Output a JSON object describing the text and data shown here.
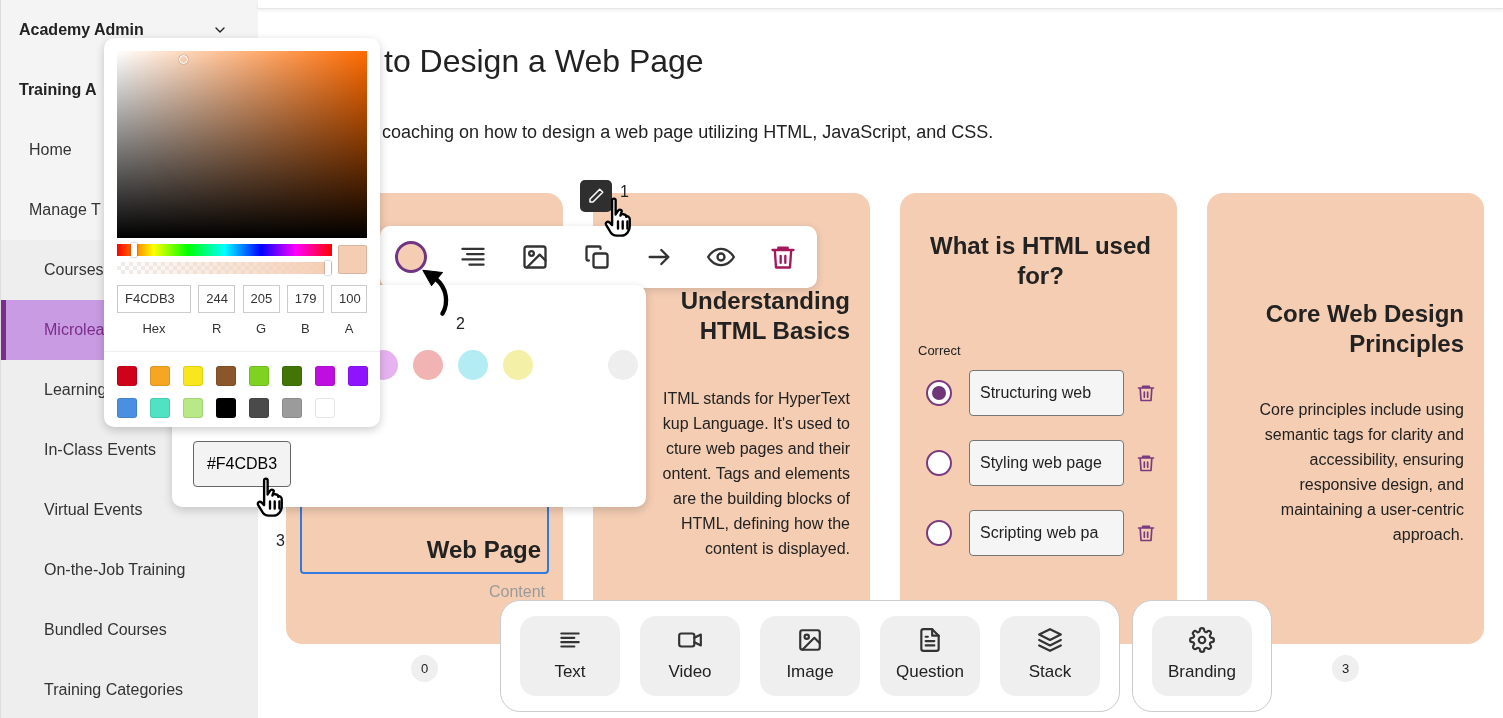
{
  "sidebar": {
    "items": [
      {
        "kind": "section",
        "label": "Academy Admin",
        "expanded": false
      },
      {
        "kind": "section",
        "label": "Training A"
      },
      {
        "kind": "item",
        "label": "Home",
        "selected": false
      },
      {
        "kind": "item",
        "label": "Manage T",
        "selected": false
      },
      {
        "kind": "subitem",
        "label": "Courses",
        "selected": false
      },
      {
        "kind": "subitem",
        "label": "Microlea",
        "selected": true
      },
      {
        "kind": "subitem",
        "label": "Learning",
        "selected": false
      },
      {
        "kind": "subitem",
        "label": "In-Class Events",
        "selected": false
      },
      {
        "kind": "subitem",
        "label": "Virtual Events",
        "selected": false
      },
      {
        "kind": "subitem",
        "label": "On-the-Job Training",
        "selected": false
      },
      {
        "kind": "subitem",
        "label": "Bundled Courses",
        "selected": false
      },
      {
        "kind": "subitem",
        "label": "Training Categories",
        "selected": false
      }
    ]
  },
  "page": {
    "title": "to Design a Web Page",
    "subtitle": "coaching on how to design a web page utilizing HTML, JavaScript, and CSS."
  },
  "cards": [
    {
      "kind": "title",
      "heading": "Web Page",
      "label": "Content",
      "page": "0"
    },
    {
      "kind": "content",
      "heading": "Understanding HTML Basics",
      "body_lines": [
        "ITML stands for HyperText",
        "kup Language. It's used to",
        "cture web pages and their",
        "ontent. Tags and elements",
        "are the building blocks of",
        "HTML, defining how the",
        "content is displayed."
      ]
    },
    {
      "kind": "question",
      "heading": "What is HTML used for?",
      "correct_label": "Correct",
      "options": [
        {
          "value": "Structuring web",
          "selected": true
        },
        {
          "value": "Styling web page",
          "selected": false
        },
        {
          "value": "Scripting web pa",
          "selected": false
        }
      ]
    },
    {
      "kind": "content",
      "heading": "Core Web Design Principles",
      "body_lines": [
        "Core principles include using",
        "semantic tags for clarity and",
        "accessibility, ensuring",
        "responsive design, and",
        "maintaining a user-centric",
        "approach."
      ],
      "page": "3"
    }
  ],
  "card_toolbar": {
    "tools": [
      {
        "kind": "color",
        "selected": true
      },
      {
        "kind": "align"
      },
      {
        "kind": "image"
      },
      {
        "kind": "copy"
      },
      {
        "kind": "arrow"
      },
      {
        "kind": "preview"
      },
      {
        "kind": "delete"
      }
    ]
  },
  "steps": [
    "1",
    "2",
    "3"
  ],
  "color_picker": {
    "hue_slider": {
      "level": 0.08
    },
    "alpha_slider": {
      "level": 0.98
    },
    "fields": [
      {
        "label": "Hex",
        "value": "F4CDB3"
      },
      {
        "label": "R",
        "value": "244"
      },
      {
        "label": "G",
        "value": "205"
      },
      {
        "label": "B",
        "value": "179"
      },
      {
        "label": "A",
        "value": "100"
      }
    ],
    "presets": [
      {
        "color": "#d0021b"
      },
      {
        "color": "#f5a623"
      },
      {
        "color": "#f8e71c"
      },
      {
        "color": "#8b572a"
      },
      {
        "color": "#7ed321"
      },
      {
        "color": "#417505"
      },
      {
        "color": "#bd10e0"
      },
      {
        "color": "#9013fe"
      },
      {
        "color": "#4a90e2"
      },
      {
        "color": "#50e3c2"
      },
      {
        "color": "#b8e986"
      },
      {
        "color": "#000000"
      },
      {
        "color": "#4a4a4a"
      },
      {
        "color": "#9b9b9b"
      },
      {
        "color": "#ffffff"
      }
    ]
  },
  "swatch_panel": {
    "colors": [
      {
        "color": "#e6b3f0"
      },
      {
        "color": "#f2b3b3"
      },
      {
        "color": "#b3ecf2"
      },
      {
        "color": "#f5f0a8"
      },
      {
        "color": "#eeeeee"
      }
    ],
    "hex_button": "#F4CDB3"
  },
  "block_toolbar": {
    "blocks": [
      {
        "kind": "text",
        "label": "Text"
      },
      {
        "kind": "video",
        "label": "Video"
      },
      {
        "kind": "image",
        "label": "Image"
      },
      {
        "kind": "question",
        "label": "Question"
      },
      {
        "kind": "stack",
        "label": "Stack"
      }
    ],
    "extra": [
      {
        "kind": "branding",
        "label": "Branding"
      }
    ]
  }
}
